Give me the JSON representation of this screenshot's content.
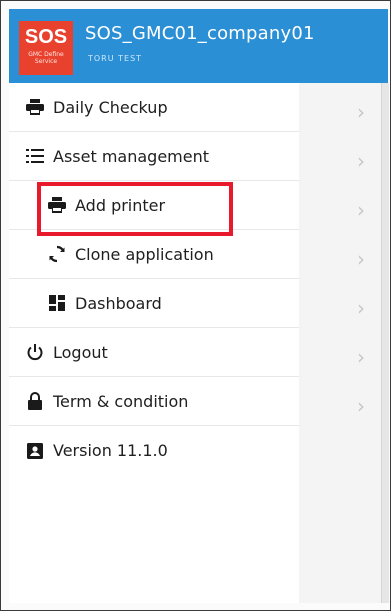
{
  "header": {
    "logo_text": "SOS",
    "logo_subtext": "GMC Define Service",
    "title": "SOS_GMC01_company01",
    "subtitle": "TORU TEST"
  },
  "menu": {
    "daily_checkup": "Daily Checkup",
    "asset_management": "Asset management",
    "add_printer": "Add printer",
    "clone_application": "Clone application",
    "dashboard": "Dashboard",
    "logout": "Logout",
    "term_condition": "Term & condition",
    "version": "Version 11.1.0"
  },
  "icons": {
    "daily_checkup": "printer-icon",
    "asset_management": "list-icon",
    "add_printer": "printer-icon",
    "clone_application": "sync-icon",
    "dashboard": "dashboard-icon",
    "logout": "power-icon",
    "term_condition": "lock-icon",
    "version": "account-box-icon"
  },
  "colors": {
    "header_bg": "#2b8fd6",
    "logo_bg": "#e8412e",
    "highlight_border": "#e8192c"
  }
}
